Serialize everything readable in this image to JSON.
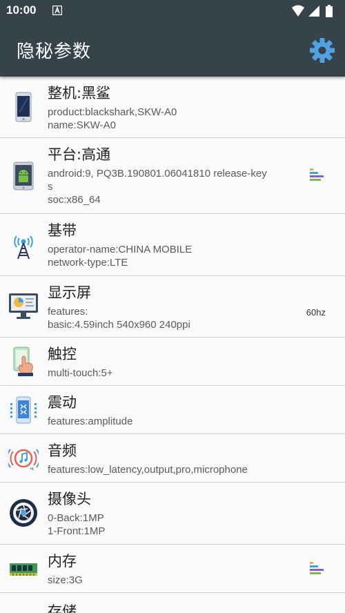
{
  "status": {
    "time": "10:00"
  },
  "appbar": {
    "title": "隐秘参数",
    "settings_icon": "gear-icon"
  },
  "items": [
    {
      "title": "整机:黑鲨",
      "lines": [
        "product:blackshark,SKW-A0",
        "name:SKW-A0"
      ],
      "icon": "phone-icon"
    },
    {
      "title": "平台:高通",
      "lines": [
        "android:9, PQ3B.190801.06041810 release-key",
        "s",
        "soc:x86_64"
      ],
      "icon": "android-icon",
      "badge": "bars-icon"
    },
    {
      "title": "基带",
      "lines": [
        "operator-name:CHINA MOBILE",
        "network-type:LTE"
      ],
      "icon": "antenna-icon"
    },
    {
      "title": "显示屏",
      "lines": [
        "features:",
        "basic:4.59inch 540x960 240ppi"
      ],
      "icon": "monitor-icon",
      "extra": "60hz"
    },
    {
      "title": "触控",
      "lines": [
        "multi-touch:5+"
      ],
      "icon": "touch-icon"
    },
    {
      "title": "震动",
      "lines": [
        "features:amplitude"
      ],
      "icon": "vibration-icon"
    },
    {
      "title": "音频",
      "lines": [
        "features:low_latency,output,pro,microphone"
      ],
      "icon": "audio-icon"
    },
    {
      "title": "摄像头",
      "lines": [
        "0-Back:1MP",
        "1-Front:1MP"
      ],
      "icon": "camera-icon"
    },
    {
      "title": "内存",
      "lines": [
        "size:3G"
      ],
      "icon": "ram-icon",
      "badge": "bars-icon"
    },
    {
      "title": "存储",
      "lines": [],
      "icon": "storage-icon"
    }
  ]
}
